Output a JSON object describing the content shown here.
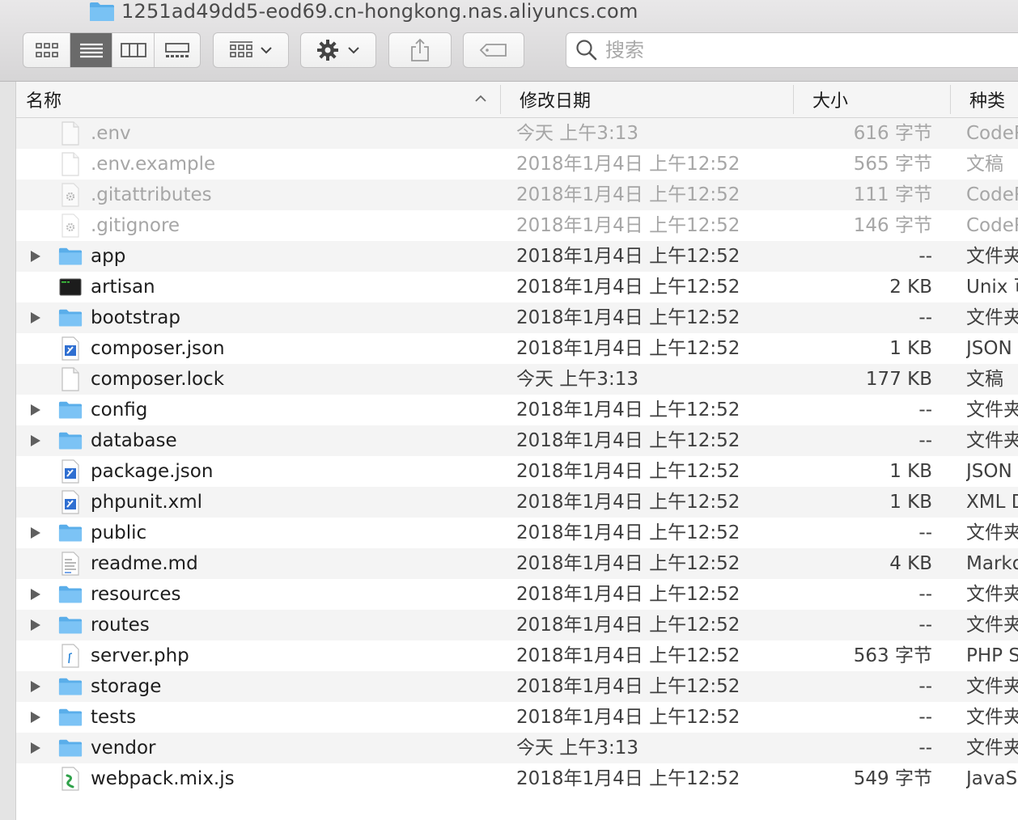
{
  "window": {
    "title": "1251ad49dd5-eod69.cn-hongkong.nas.aliyuncs.com"
  },
  "toolbar": {
    "view_modes": [
      "icon-view",
      "list-view",
      "column-view",
      "gallery-view"
    ],
    "active_view": "list-view",
    "group_button_icon": "group-by-icon",
    "action_button_icon": "gear-icon",
    "share_button_icon": "share-icon",
    "tags_button_icon": "tag-icon",
    "search_placeholder": "搜索"
  },
  "columns": {
    "name": "名称",
    "date": "修改日期",
    "size": "大小",
    "kind": "种类",
    "sort_indicator": "^"
  },
  "colors": {
    "folder_blue": "#6fb7f0",
    "active_segment": "#6a6a6a",
    "dim_text": "#a6a6a6"
  },
  "files": [
    {
      "name": ".env",
      "date": "今天 上午3:13",
      "size": "616 字节",
      "kind": "CodeR",
      "icon": "generic-document-icon",
      "folder": false,
      "dim": true
    },
    {
      "name": ".env.example",
      "date": "2018年1月4日 上午12:52",
      "size": "565 字节",
      "kind": "文稿",
      "icon": "generic-document-icon",
      "folder": false,
      "dim": true
    },
    {
      "name": ".gitattributes",
      "date": "2018年1月4日 上午12:52",
      "size": "111 字节",
      "kind": "CodeR",
      "icon": "settings-document-icon",
      "folder": false,
      "dim": true
    },
    {
      "name": ".gitignore",
      "date": "2018年1月4日 上午12:52",
      "size": "146 字节",
      "kind": "CodeR",
      "icon": "settings-document-icon",
      "folder": false,
      "dim": true
    },
    {
      "name": "app",
      "date": "2018年1月4日 上午12:52",
      "size": "--",
      "kind": "文件夹",
      "icon": "folder-icon",
      "folder": true,
      "dim": false
    },
    {
      "name": "artisan",
      "date": "2018年1月4日 上午12:52",
      "size": "2 KB",
      "kind": "Unix 可",
      "icon": "terminal-icon",
      "folder": false,
      "dim": false
    },
    {
      "name": "bootstrap",
      "date": "2018年1月4日 上午12:52",
      "size": "--",
      "kind": "文件夹",
      "icon": "folder-icon",
      "folder": true,
      "dim": false
    },
    {
      "name": "composer.json",
      "date": "2018年1月4日 上午12:52",
      "size": "1 KB",
      "kind": "JSON",
      "icon": "code-document-icon",
      "folder": false,
      "dim": false
    },
    {
      "name": "composer.lock",
      "date": "今天 上午3:13",
      "size": "177 KB",
      "kind": "文稿",
      "icon": "generic-document-icon",
      "folder": false,
      "dim": false
    },
    {
      "name": "config",
      "date": "2018年1月4日 上午12:52",
      "size": "--",
      "kind": "文件夹",
      "icon": "folder-icon",
      "folder": true,
      "dim": false
    },
    {
      "name": "database",
      "date": "2018年1月4日 上午12:52",
      "size": "--",
      "kind": "文件夹",
      "icon": "folder-icon",
      "folder": true,
      "dim": false
    },
    {
      "name": "package.json",
      "date": "2018年1月4日 上午12:52",
      "size": "1 KB",
      "kind": "JSON",
      "icon": "code-document-icon",
      "folder": false,
      "dim": false
    },
    {
      "name": "phpunit.xml",
      "date": "2018年1月4日 上午12:52",
      "size": "1 KB",
      "kind": "XML D",
      "icon": "code-document-icon",
      "folder": false,
      "dim": false
    },
    {
      "name": "public",
      "date": "2018年1月4日 上午12:52",
      "size": "--",
      "kind": "文件夹",
      "icon": "folder-icon",
      "folder": true,
      "dim": false
    },
    {
      "name": "readme.md",
      "date": "2018年1月4日 上午12:52",
      "size": "4 KB",
      "kind": "Markd",
      "icon": "text-document-icon",
      "folder": false,
      "dim": false
    },
    {
      "name": "resources",
      "date": "2018年1月4日 上午12:52",
      "size": "--",
      "kind": "文件夹",
      "icon": "folder-icon",
      "folder": true,
      "dim": false
    },
    {
      "name": "routes",
      "date": "2018年1月4日 上午12:52",
      "size": "--",
      "kind": "文件夹",
      "icon": "folder-icon",
      "folder": true,
      "dim": false
    },
    {
      "name": "server.php",
      "date": "2018年1月4日 上午12:52",
      "size": "563 字节",
      "kind": "PHP S",
      "icon": "php-document-icon",
      "folder": false,
      "dim": false
    },
    {
      "name": "storage",
      "date": "2018年1月4日 上午12:52",
      "size": "--",
      "kind": "文件夹",
      "icon": "folder-icon",
      "folder": true,
      "dim": false
    },
    {
      "name": "tests",
      "date": "2018年1月4日 上午12:52",
      "size": "--",
      "kind": "文件夹",
      "icon": "folder-icon",
      "folder": true,
      "dim": false
    },
    {
      "name": "vendor",
      "date": "今天 上午3:13",
      "size": "--",
      "kind": "文件夹",
      "icon": "folder-icon",
      "folder": true,
      "dim": false
    },
    {
      "name": "webpack.mix.js",
      "date": "2018年1月4日 上午12:52",
      "size": "549 字节",
      "kind": "JavaS",
      "icon": "js-document-icon",
      "folder": false,
      "dim": false
    }
  ]
}
